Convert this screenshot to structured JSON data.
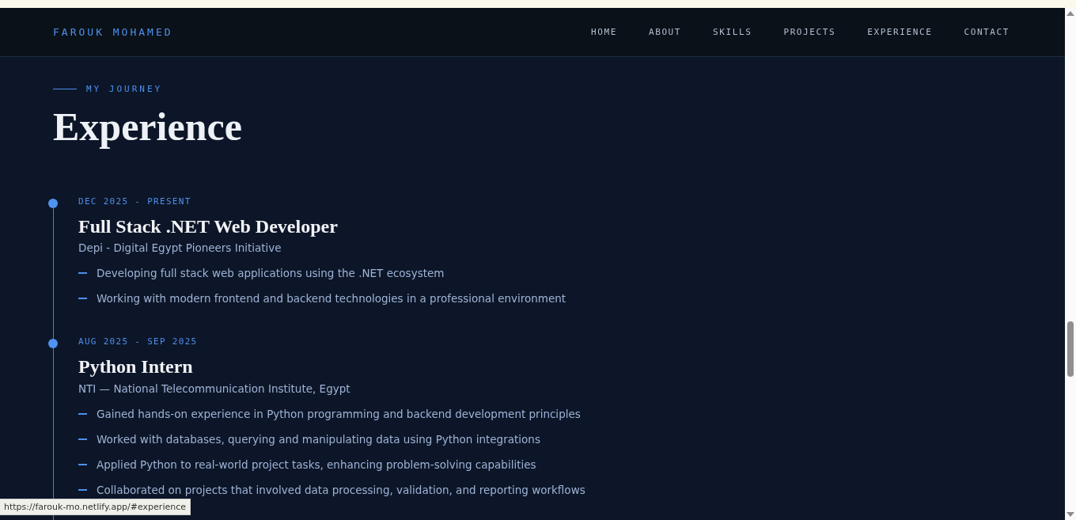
{
  "nav": {
    "brand": "FAROUK MOHAMED",
    "links": [
      {
        "label": "HOME",
        "selected": false
      },
      {
        "label": "ABOUT",
        "selected": false
      },
      {
        "label": "SKILLS",
        "selected": false
      },
      {
        "label": "PROJECTS",
        "selected": false
      },
      {
        "label": "EXPERIENCE",
        "selected": false
      },
      {
        "label": "CONTACT",
        "selected": false
      }
    ]
  },
  "section": {
    "eyebrow": "MY JOURNEY",
    "title": "Experience"
  },
  "timeline": [
    {
      "date": "DEC 2025 - PRESENT",
      "role": "Full Stack .NET Web Developer",
      "company": "Depi - Digital Egypt Pioneers Initiative",
      "points": [
        "Developing full stack web applications using the .NET ecosystem",
        "Working with modern frontend and backend technologies in a professional environment"
      ]
    },
    {
      "date": "AUG 2025 - SEP 2025",
      "role": "Python Intern",
      "company": "NTI — National Telecommunication Institute, Egypt",
      "points": [
        "Gained hands-on experience in Python programming and backend development principles",
        "Worked with databases, querying and manipulating data using Python integrations",
        "Applied Python to real-world project tasks, enhancing problem-solving capabilities",
        "Collaborated on projects that involved data processing, validation, and reporting workflows"
      ]
    }
  ],
  "status_url": "https://farouk-mo.netlify.app/#experience"
}
